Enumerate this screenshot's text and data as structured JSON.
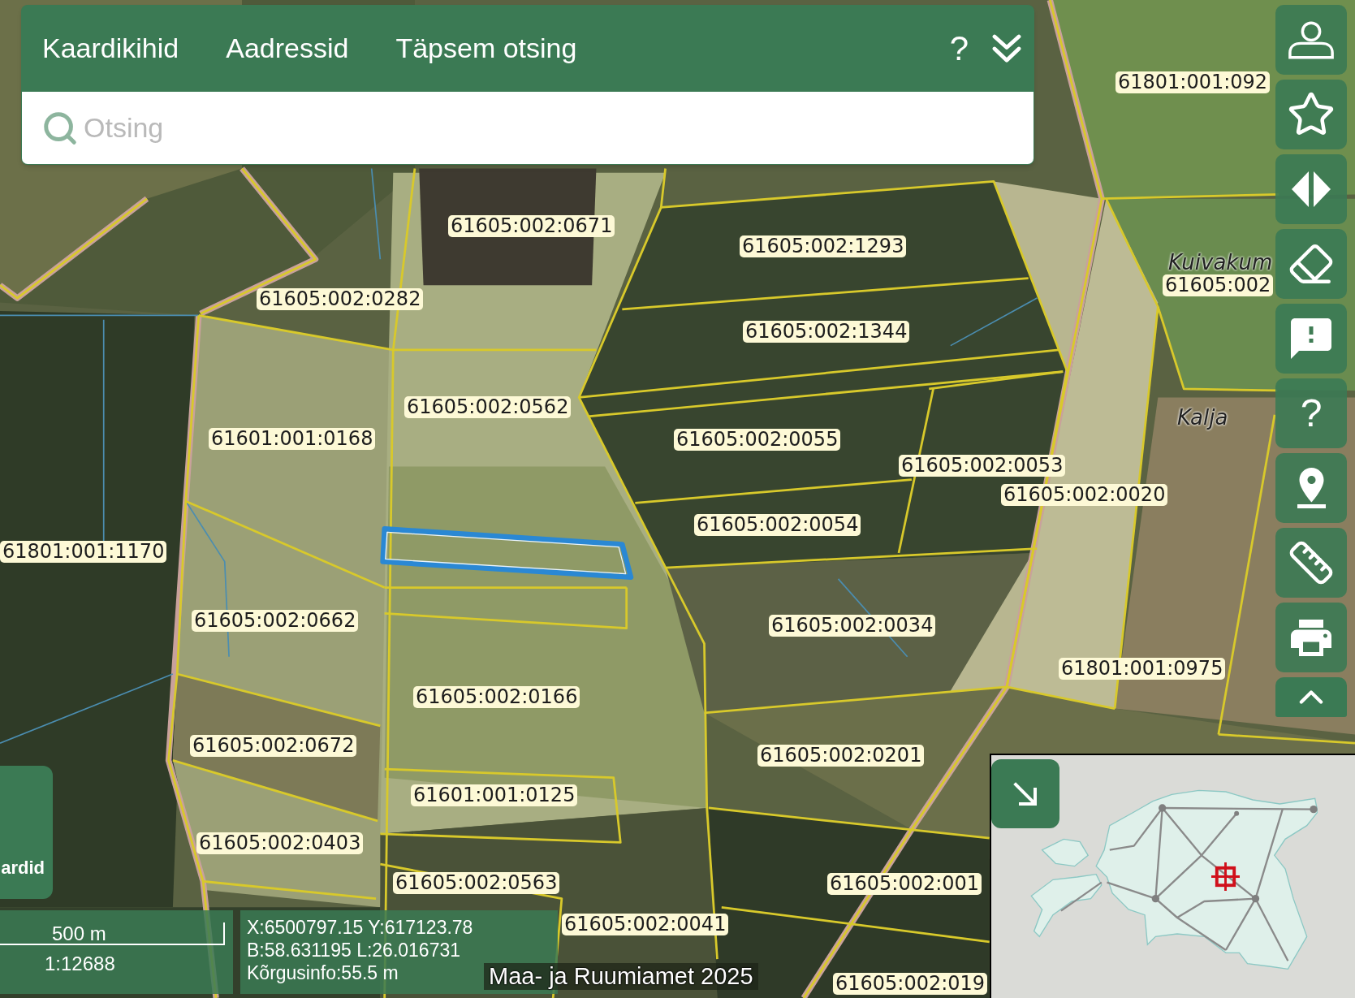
{
  "search_panel": {
    "tabs": [
      {
        "label": "Kaardikihid"
      },
      {
        "label": "Aadressid"
      },
      {
        "label": "Täpsem otsing"
      }
    ],
    "help_label": "?",
    "search": {
      "placeholder": "Otsing"
    }
  },
  "toolbar": {
    "help_label": "?"
  },
  "map_labels": [
    {
      "text": "61801:001:092",
      "kind": "parcel"
    },
    {
      "text": "61605:002:0671",
      "kind": "parcel"
    },
    {
      "text": "61605:002:1293",
      "kind": "parcel"
    },
    {
      "text": "Kuivakum",
      "kind": "place"
    },
    {
      "text": "61605:002",
      "kind": "parcel"
    },
    {
      "text": "61605:002:0282",
      "kind": "parcel"
    },
    {
      "text": "61605:002:1344",
      "kind": "parcel"
    },
    {
      "text": "61605:002:0562",
      "kind": "parcel"
    },
    {
      "text": "Kalja",
      "kind": "place"
    },
    {
      "text": "61601:001:0168",
      "kind": "parcel"
    },
    {
      "text": "61605:002:0055",
      "kind": "parcel"
    },
    {
      "text": "61605:002:0053",
      "kind": "parcel"
    },
    {
      "text": "61605:002:0020",
      "kind": "parcel"
    },
    {
      "text": "61605:002:0054",
      "kind": "parcel"
    },
    {
      "text": "61801:001:1170",
      "kind": "parcel"
    },
    {
      "text": "61605:002:0662",
      "kind": "parcel"
    },
    {
      "text": "61605:002:0034",
      "kind": "parcel"
    },
    {
      "text": "61801:001:0975",
      "kind": "parcel"
    },
    {
      "text": "61605:002:0166",
      "kind": "parcel"
    },
    {
      "text": "61605:002:0672",
      "kind": "parcel"
    },
    {
      "text": "61605:002:0201",
      "kind": "parcel"
    },
    {
      "text": "61601:001:0125",
      "kind": "parcel"
    },
    {
      "text": "61605:002:0403",
      "kind": "parcel"
    },
    {
      "text": "61605:002:0563",
      "kind": "parcel"
    },
    {
      "text": "61605:002:001",
      "kind": "parcel"
    },
    {
      "text": "61605:002:0041",
      "kind": "parcel"
    },
    {
      "text": "61605:002:019",
      "kind": "parcel"
    }
  ],
  "side_tab": {
    "label": "ardid"
  },
  "scale_bar": {
    "distance": "500 m",
    "ratio": "1:12688"
  },
  "coordinates": [
    "X:6500797.15 Y:617123.78",
    "B:58.631195 L:26.016731",
    "Kõrgusinfo:55.5 m"
  ],
  "attribution": "Maa- ja Ruumiamet 2025"
}
